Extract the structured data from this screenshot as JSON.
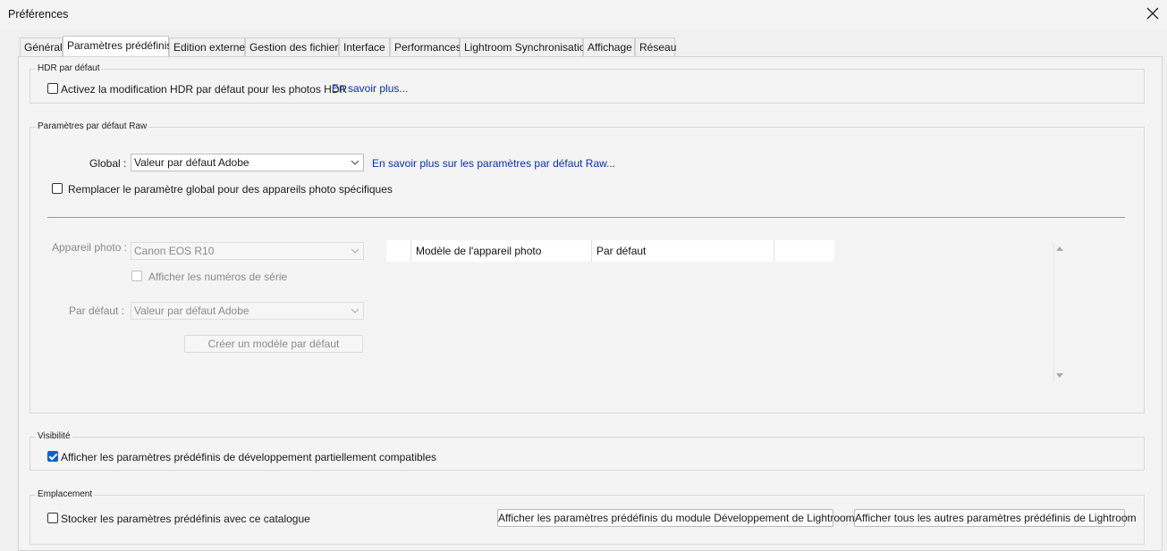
{
  "window": {
    "title": "Préférences"
  },
  "tabs": [
    {
      "label": "Général"
    },
    {
      "label": "Paramètres prédéfinis"
    },
    {
      "label": "Edition externe"
    },
    {
      "label": "Gestion des fichiers"
    },
    {
      "label": "Interface"
    },
    {
      "label": "Performances"
    },
    {
      "label": "Lightroom Synchronisation"
    },
    {
      "label": "Affichage"
    },
    {
      "label": "Réseau"
    }
  ],
  "hdr": {
    "legend": "HDR par défaut",
    "checkbox_label": "Activez la modification HDR par défaut pour les photos HDR",
    "checked": false,
    "link": "En savoir plus..."
  },
  "raw": {
    "legend": "Paramètres par défaut Raw",
    "global_label": "Global :",
    "global_value": "Valeur par défaut Adobe",
    "global_link": "En savoir plus sur les paramètres par défaut Raw...",
    "override_label": "Remplacer le paramètre global pour des appareils photo spécifiques",
    "override_checked": false,
    "camera_label": "Appareil photo :",
    "camera_value": "Canon EOS R10",
    "serial_label": "Afficher les numéros de série",
    "default_label": "Par défaut :",
    "default_value": "Valeur par défaut Adobe",
    "create_button": "Créer un modèle par défaut",
    "table_headers": [
      "",
      "Modèle de l'appareil photo",
      "Par défaut",
      ""
    ]
  },
  "visibility": {
    "legend": "Visibilité",
    "checkbox_label": "Afficher les paramètres prédéfinis de développement partiellement compatibles",
    "checked": true
  },
  "location": {
    "legend": "Emplacement",
    "checkbox_label": "Stocker les paramètres prédéfinis avec ce catalogue",
    "checked": false,
    "button_develop": "Afficher les paramètres prédéfinis du module Développement de Lightroom",
    "button_all": "Afficher tous les autres paramètres prédéfinis de Lightroom"
  },
  "colors": {
    "link": "#0b2db0",
    "checkbox_checked": "#0a64c8"
  }
}
